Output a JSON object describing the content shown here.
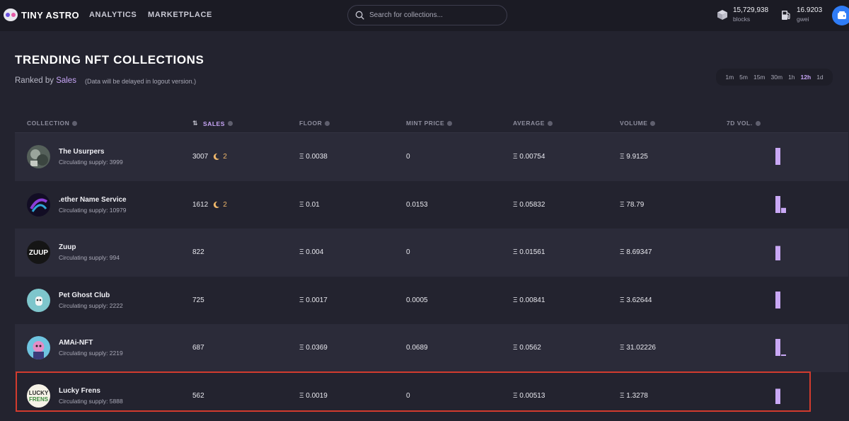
{
  "brand": {
    "name": "TINY ASTRO"
  },
  "nav": {
    "analytics": "ANALYTICS",
    "marketplace": "MARKETPLACE"
  },
  "search": {
    "placeholder": "Search for collections..."
  },
  "stats": {
    "blocks_value": "15,729,938",
    "blocks_unit": "blocks",
    "gas_value": "16.9203",
    "gas_unit": "gwei"
  },
  "page": {
    "title": "TRENDING NFT COLLECTIONS",
    "ranked_prefix": "Ranked by",
    "ranked_by": "Sales",
    "note": "(Data will be delayed in logout version.)"
  },
  "timeframes": [
    "1m",
    "5m",
    "15m",
    "30m",
    "1h",
    "12h",
    "1d"
  ],
  "active_timeframe": "12h",
  "columns": {
    "collection": "COLLECTION",
    "sales": "SALES",
    "floor": "FLOOR",
    "mint_price": "MINT PRICE",
    "average": "AVERAGE",
    "volume": "VOLUME",
    "vol7d": "7D VOL."
  },
  "rows": [
    {
      "name": "The Usurpers",
      "supply": "Circulating supply: 3999",
      "sales": "3007",
      "moon_count": "2",
      "floor": "Ξ 0.0038",
      "mint": "0",
      "average": "Ξ 0.00754",
      "volume": "Ξ 9.9125",
      "vol7d": [
        1.0
      ]
    },
    {
      "name": ".ether Name Service",
      "supply": "Circulating supply: 10979",
      "sales": "1612",
      "moon_count": "2",
      "floor": "Ξ 0.01",
      "mint": "0.0153",
      "average": "Ξ 0.05832",
      "volume": "Ξ 78.79",
      "vol7d": [
        1.0,
        0.3
      ]
    },
    {
      "name": "Zuup",
      "supply": "Circulating supply: 994",
      "sales": "822",
      "moon_count": "",
      "floor": "Ξ 0.004",
      "mint": "0",
      "average": "Ξ 0.01561",
      "volume": "Ξ 8.69347",
      "vol7d": [
        0.85
      ]
    },
    {
      "name": "Pet Ghost Club",
      "supply": "Circulating supply: 2222",
      "sales": "725",
      "moon_count": "",
      "floor": "Ξ 0.0017",
      "mint": "0.0005",
      "average": "Ξ 0.00841",
      "volume": "Ξ 3.62644",
      "vol7d": [
        1.0
      ]
    },
    {
      "name": "AMAi-NFT",
      "supply": "Circulating supply: 2219",
      "sales": "687",
      "moon_count": "",
      "floor": "Ξ 0.0369",
      "mint": "0.0689",
      "average": "Ξ 0.0562",
      "volume": "Ξ 31.02226",
      "vol7d": [
        1.0,
        0.08
      ]
    },
    {
      "name": "Lucky Frens",
      "supply": "Circulating supply: 5888",
      "sales": "562",
      "moon_count": "",
      "floor": "Ξ 0.0019",
      "mint": "0",
      "average": "Ξ 0.00513",
      "volume": "Ξ 1.3278",
      "vol7d": [
        0.9
      ]
    }
  ],
  "colors": {
    "accent": "#c8a6f7",
    "bar": "#c9a8f5",
    "highlight": "#d23b2e",
    "wallet": "#2f7cf6"
  }
}
